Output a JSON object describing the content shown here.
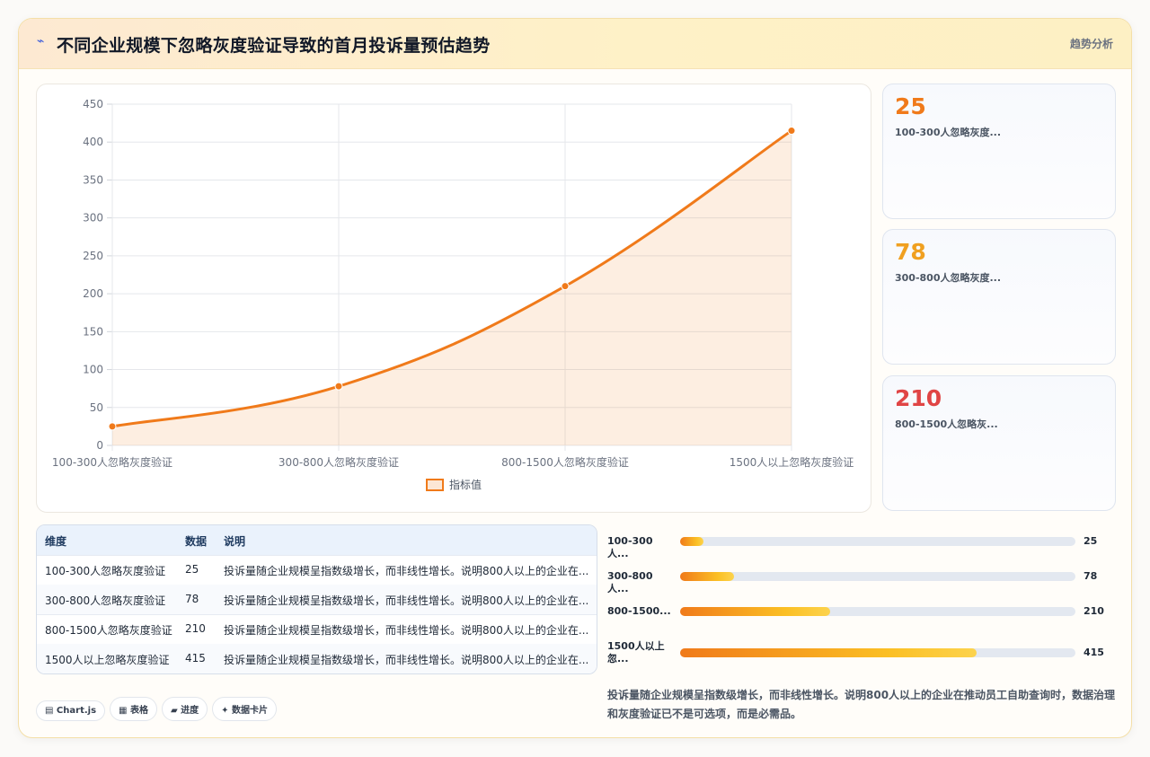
{
  "header": {
    "icon": "lightning-icon",
    "title": "不同企业规模下忽略灰度验证导致的首月投诉量预估趋势",
    "tag": "趋势分析"
  },
  "chart_data": {
    "type": "line",
    "fill": true,
    "categories": [
      "100-300人忽略灰度验证",
      "300-800人忽略灰度验证",
      "800-1500人忽略灰度验证",
      "1500人以上忽略灰度验证"
    ],
    "series": [
      {
        "name": "指标值",
        "values": [
          25,
          78,
          210,
          415
        ],
        "color": "#f07a1a"
      }
    ],
    "ylim": [
      0,
      450
    ],
    "yticks": [
      0,
      50,
      100,
      150,
      200,
      250,
      300,
      350,
      400,
      450
    ],
    "grid": true,
    "legend": "bottom"
  },
  "stats": [
    {
      "value": "25",
      "label": "100-300人忽略灰度...",
      "color": "#f07a1a"
    },
    {
      "value": "78",
      "label": "300-800人忽略灰度...",
      "color": "#f0a020"
    },
    {
      "value": "210",
      "label": "800-1500人忽略灰...",
      "color": "#e04545"
    }
  ],
  "table": {
    "headers": [
      "维度",
      "数据",
      "说明"
    ],
    "rows": [
      [
        "100-300人忽略灰度验证",
        "25",
        "投诉量随企业规模呈指数级增长，而非线性增长。说明800人以上的企业在..."
      ],
      [
        "300-800人忽略灰度验证",
        "78",
        "投诉量随企业规模呈指数级增长，而非线性增长。说明800人以上的企业在..."
      ],
      [
        "800-1500人忽略灰度验证",
        "210",
        "投诉量随企业规模呈指数级增长，而非线性增长。说明800人以上的企业在..."
      ],
      [
        "1500人以上忽略灰度验证",
        "415",
        "投诉量随企业规模呈指数级增长，而非线性增长。说明800人以上的企业在..."
      ]
    ]
  },
  "progress": [
    {
      "label": "100-300人...",
      "value": "25",
      "fraction": 0.06
    },
    {
      "label": "300-800人...",
      "value": "78",
      "fraction": 0.1364
    },
    {
      "label": "800-1500...",
      "value": "210",
      "fraction": 0.3795
    },
    {
      "label": "1500人以上忽...",
      "value": "415",
      "fraction": 0.75
    }
  ],
  "note": "投诉量随企业规模呈指数级增长，而非线性增长。说明800人以上的企业在推动员工自助查询时，数据治理和灰度验证已不是可选项，而是必需品。",
  "chips": [
    "▤ Chart.js",
    "▦ 表格",
    "▰ 进度",
    "✦ 数据卡片"
  ]
}
